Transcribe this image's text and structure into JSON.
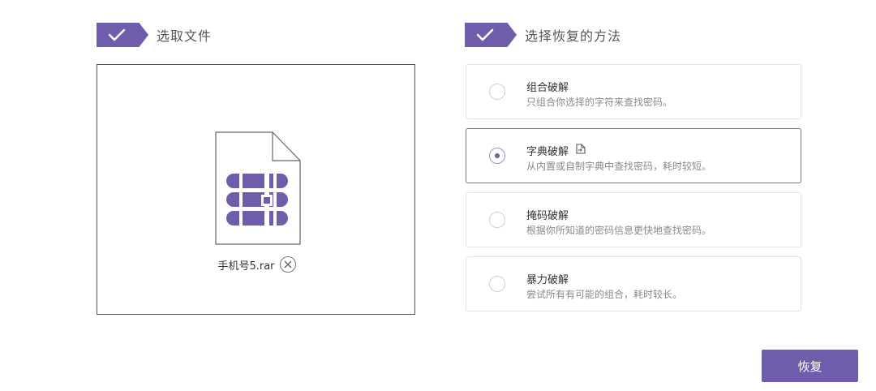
{
  "step1": {
    "title": "选取文件"
  },
  "step2": {
    "title": "选择恢复的方法"
  },
  "file": {
    "name": "手机号5.rar",
    "icon": "rar-archive-icon"
  },
  "methods": [
    {
      "title": "组合破解",
      "desc": "只组合你选择的字符来查找密码。",
      "selected": false
    },
    {
      "title": "字典破解",
      "desc": "从内置或自制字典中查找密码，耗时较短。",
      "selected": true
    },
    {
      "title": "掩码破解",
      "desc": "根据你所知道的密码信息更快地查找密码。",
      "selected": false
    },
    {
      "title": "暴力破解",
      "desc": "尝试所有有可能的组合，耗时较长。",
      "selected": false
    }
  ],
  "recover_button": "恢复",
  "colors": {
    "accent": "#6f5cab",
    "border": "#555555",
    "muted_text": "#8a8a8a"
  }
}
